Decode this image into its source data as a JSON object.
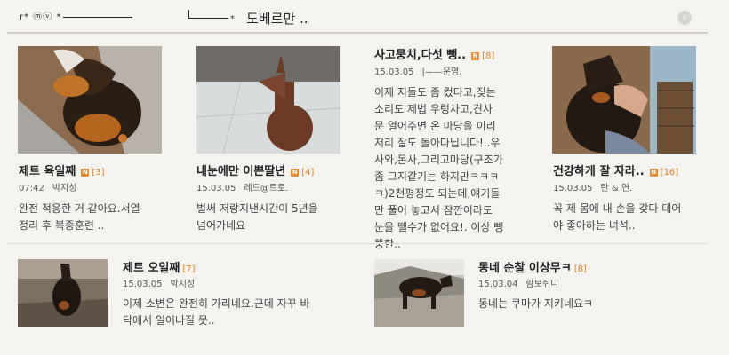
{
  "header": {
    "deco_left": "r* ⓜⓥ *",
    "cafe_title": "도베르만 ..",
    "more_icon": "chevron-right-icon"
  },
  "new_icon_text": "N",
  "top_posts": [
    {
      "title": "제트 육일째",
      "comments": "[3]",
      "date": "07:42",
      "author": "박지성",
      "excerpt": "완전 적응한 거 같아요.서열\n정리 후 복종훈련 .."
    },
    {
      "title": "내눈에만 이쁜딸년",
      "comments": "[4]",
      "date": "15.03.05",
      "author": "레드@트로.",
      "excerpt": "벌써 저랑지낸시간이 5년을\n넘어가네요"
    },
    {
      "title": "사고뭉치,다섯 뺑..",
      "comments": "[8]",
      "date": "15.03.05",
      "author": "|——운영.",
      "excerpt": "이제 지들도 좀 컸다고,짖는\n소리도 제법 우렁차고,견사\n문 열어주면 온 마당을 이리\n저리 잘도 돌아다닙니다!..우\n사와,돈사,그리고마당(구조가\n좀 그지같기는 하지만ㅋㅋㅋ\nㅋ)2천평정도 되는데,얘기들\n만 풀어 놓고서 잠깐이라도\n눈을 뗄수가 없어요!. 이상 뺑\n뚱한.."
    },
    {
      "title": "건강하게 잘 자라..",
      "comments": "[16]",
      "date": "15.03.05",
      "author": "탄 & 연.",
      "excerpt": "꼭 제 몸에 내 손을 갖다 대어\n야 좋아하는 녀석.."
    }
  ],
  "bottom_posts": [
    {
      "title": "제트 오일째",
      "comments": "[7]",
      "date": "15.03.05",
      "author": "박지성",
      "excerpt": "이제 소변은 완전히 가리네요.근데 자꾸 바\n닥에서 일어나질 못.."
    },
    {
      "title": "동네 순찰 이상무ㅋ",
      "comments": "[8]",
      "date": "15.03.04",
      "author": "람보쥐니",
      "excerpt": "동네는 쿠마가 지키네요ㅋ"
    }
  ]
}
